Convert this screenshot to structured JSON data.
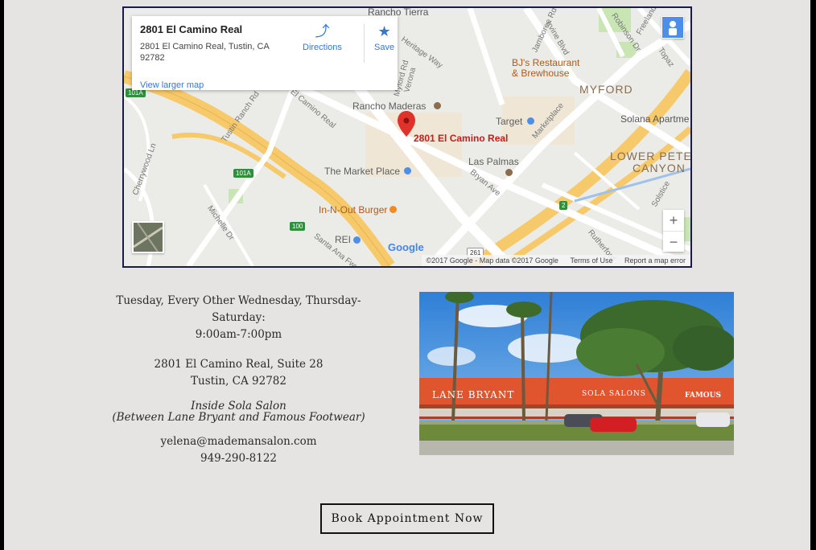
{
  "map": {
    "place_name": "2801 El Camino Real",
    "place_address": "2801 El Camino Real, Tustin, CA 92782",
    "directions_label": "Directions",
    "save_label": "Save",
    "view_larger_label": "View larger map",
    "pin_label": "2801 El Camino Real",
    "labels": {
      "rancho_tierra": "Rancho Tierra",
      "jamboree": "Jamboree Rd",
      "irvine_blvd": "Irvine Blvd",
      "robinson": "Robinson Dr",
      "freeland": "Freeland",
      "topaz": "Topaz",
      "bjs": "BJ's Restaurant\n& Brewhouse",
      "myford": "MYFORD",
      "rancho_maderas": "Rancho Maderas",
      "target": "Target",
      "solana": "Solana Apartme",
      "marketplace": "Marketplace",
      "lower_peters": "LOWER PETE",
      "canyon": "CANYON",
      "las_palmas": "Las Palmas",
      "bryan_ave": "Bryan Ave",
      "market_place": "The Market Place",
      "in_n_out": "In-N-Out Burger",
      "rei": "REI",
      "tustin_ranch": "Tustin Ranch Rd",
      "el_camino": "El Camino Real",
      "cherrywood": "Cherrywood Ln",
      "michelle": "Michelle Dr",
      "santa_ana": "Santa Ana Fwy",
      "myford_rd": "Myford Rd",
      "verona": "Verona",
      "heritage": "Heritage Way",
      "rutherford": "Rutherford",
      "solstice": "Solstice"
    },
    "shields": [
      "101A",
      "101A",
      "100",
      "261",
      "2"
    ],
    "zoom_in": "+",
    "zoom_out": "−",
    "google": "Google",
    "footer": {
      "copyright": "©2017 Google - Map data ©2017 Google",
      "terms": "Terms of Use",
      "report": "Report a map error"
    },
    "colors": {
      "pin": "#e0322a",
      "highway": "#f6c96b",
      "road": "#ffffff",
      "poi": "#4d8ee8",
      "food": "#f08a24"
    }
  },
  "hours": {
    "days": "Tuesday, Every Other Wednesday, Thursday-Saturday:",
    "time": "9:00am-7:00pm"
  },
  "address": {
    "line1": "2801 El Camino Real, Suite 28",
    "line2": "Tustin, CA 92782"
  },
  "location_note": {
    "line1": "Inside Sola Salon",
    "line2": "(Between Lane Bryant and Famous Footwear)"
  },
  "contact": {
    "email": "yelena@mademansalon.com",
    "phone": "949-290-8122"
  },
  "photo": {
    "signs": [
      "LANE BRYANT",
      "SOLA SALONS",
      "FAMOUS"
    ]
  },
  "book_button": "Book Appointment Now"
}
